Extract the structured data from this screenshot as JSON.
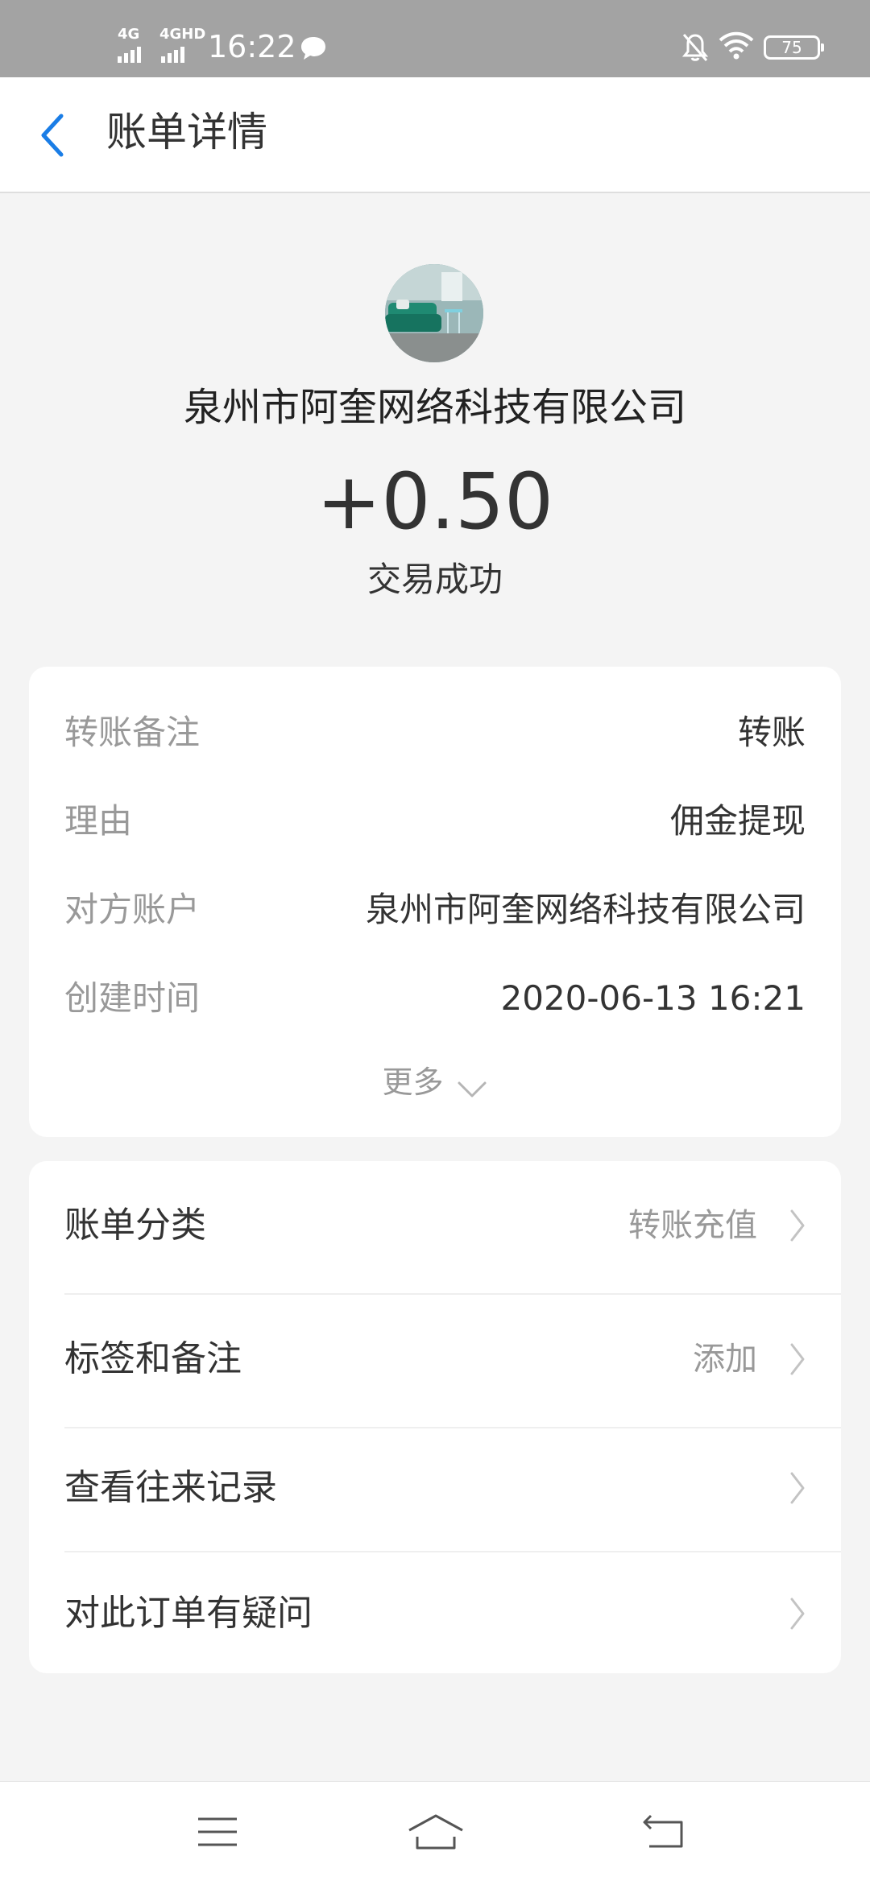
{
  "status_bar": {
    "signal_1": "4G",
    "signal_2": "4GHD",
    "time": "16:22",
    "battery": "75",
    "icons": [
      "message-icon",
      "bell-off-icon",
      "wifi-icon",
      "battery-icon"
    ]
  },
  "header": {
    "title": "账单详情"
  },
  "summary": {
    "merchant_name": "泉州市阿奎网络科技有限公司",
    "amount": "+0.50",
    "status": "交易成功"
  },
  "details": {
    "rows": [
      {
        "label": "转账备注",
        "value": "转账"
      },
      {
        "label": "理由",
        "value": "佣金提现"
      },
      {
        "label": "对方账户",
        "value": "泉州市阿奎网络科技有限公司"
      },
      {
        "label": "创建时间",
        "value": "2020-06-13 16:21"
      }
    ],
    "more_label": "更多"
  },
  "menu": {
    "items": [
      {
        "label": "账单分类",
        "value": "转账充值"
      },
      {
        "label": "标签和备注",
        "value": "添加"
      },
      {
        "label": "查看往来记录",
        "value": ""
      },
      {
        "label": "对此订单有疑问",
        "value": ""
      }
    ]
  },
  "colors": {
    "accent": "#1a7de6",
    "status_bar_bg": "#a3a3a3",
    "page_bg": "#f4f4f4",
    "muted_text": "#999999"
  }
}
